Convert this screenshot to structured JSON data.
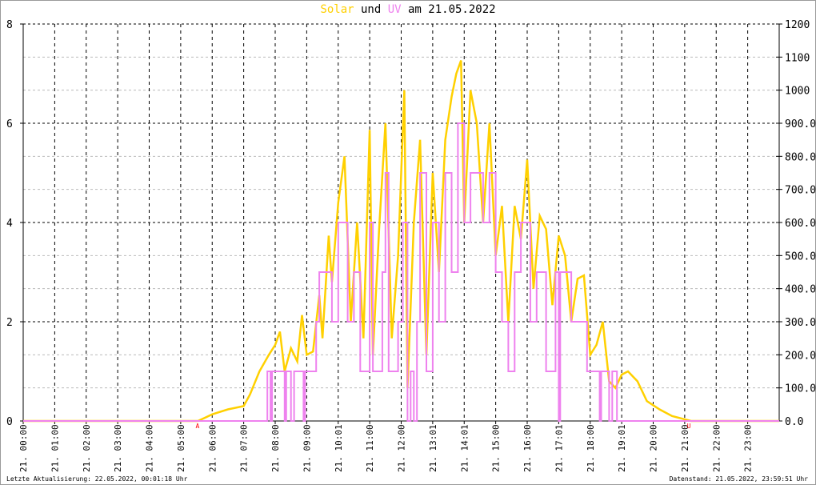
{
  "title": {
    "part1": "Solar",
    "part2": " und ",
    "part3": "UV",
    "part4": " am 21.05.2022"
  },
  "footer": {
    "left": "Letzte Aktualisierung: 22.05.2022, 00:01:18 Uhr",
    "right": "Datenstand: 21.05.2022, 23:59:51 Uhr"
  },
  "colors": {
    "solar": "#ffd000",
    "uv": "#ee82ee",
    "marker": "#ff0000"
  },
  "chart_data": {
    "type": "line",
    "title": "Solar und UV am 21.05.2022",
    "xlim": [
      0,
      24
    ],
    "ylim_left": [
      0,
      8
    ],
    "ylim_right": [
      0,
      1200
    ],
    "left_ticks": [
      "0",
      "2",
      "4",
      "6",
      "8"
    ],
    "right_ticks": [
      "0.0",
      "100.0",
      "200.0",
      "300.0",
      "400.0",
      "500.0",
      "600.0",
      "700.0",
      "800.0",
      "900.0",
      "1000",
      "1100",
      "1200"
    ],
    "x_tick_labels": [
      "21. 00:00",
      "21. 01:00",
      "21. 02:00",
      "21. 03:00",
      "21. 04:00",
      "21. 05:00",
      "21. 06:00",
      "21. 07:00",
      "21. 08:00",
      "21. 09:00",
      "21. 10:01",
      "21. 11:00",
      "21. 12:00",
      "21. 13:01",
      "21. 14:01",
      "21. 15:00",
      "21. 16:00",
      "21. 17:01",
      "21. 18:00",
      "21. 19:01",
      "21. 20:00",
      "21. 21:00",
      "21. 22:00",
      "21. 23:00"
    ],
    "markers": [
      {
        "label": "A",
        "x": 5.55
      },
      {
        "label": "U",
        "x": 21.15
      }
    ],
    "series": [
      {
        "name": "Solar",
        "axis": "right",
        "points": [
          [
            0,
            0
          ],
          [
            5.55,
            0
          ],
          [
            6.0,
            20
          ],
          [
            6.5,
            35
          ],
          [
            7.0,
            45
          ],
          [
            7.2,
            80
          ],
          [
            7.5,
            150
          ],
          [
            7.8,
            200
          ],
          [
            8.0,
            230
          ],
          [
            8.15,
            270
          ],
          [
            8.3,
            150
          ],
          [
            8.5,
            220
          ],
          [
            8.7,
            180
          ],
          [
            8.85,
            320
          ],
          [
            9.0,
            200
          ],
          [
            9.2,
            210
          ],
          [
            9.4,
            380
          ],
          [
            9.5,
            250
          ],
          [
            9.7,
            560
          ],
          [
            9.8,
            420
          ],
          [
            10.0,
            660
          ],
          [
            10.2,
            800
          ],
          [
            10.4,
            300
          ],
          [
            10.6,
            600
          ],
          [
            10.8,
            250
          ],
          [
            11.0,
            880
          ],
          [
            11.1,
            200
          ],
          [
            11.3,
            580
          ],
          [
            11.5,
            900
          ],
          [
            11.7,
            250
          ],
          [
            11.9,
            500
          ],
          [
            12.1,
            1000
          ],
          [
            12.2,
            100
          ],
          [
            12.4,
            600
          ],
          [
            12.6,
            850
          ],
          [
            12.8,
            200
          ],
          [
            13.0,
            750
          ],
          [
            13.2,
            450
          ],
          [
            13.4,
            850
          ],
          [
            13.6,
            980
          ],
          [
            13.75,
            1050
          ],
          [
            13.9,
            1090
          ],
          [
            14.0,
            600
          ],
          [
            14.2,
            1000
          ],
          [
            14.4,
            900
          ],
          [
            14.6,
            600
          ],
          [
            14.8,
            900
          ],
          [
            15.0,
            500
          ],
          [
            15.2,
            650
          ],
          [
            15.4,
            300
          ],
          [
            15.6,
            650
          ],
          [
            15.8,
            550
          ],
          [
            16.0,
            790
          ],
          [
            16.2,
            400
          ],
          [
            16.4,
            620
          ],
          [
            16.6,
            580
          ],
          [
            16.8,
            350
          ],
          [
            17.0,
            560
          ],
          [
            17.2,
            500
          ],
          [
            17.4,
            300
          ],
          [
            17.6,
            430
          ],
          [
            17.8,
            440
          ],
          [
            18.0,
            200
          ],
          [
            18.2,
            230
          ],
          [
            18.4,
            300
          ],
          [
            18.6,
            120
          ],
          [
            18.8,
            100
          ],
          [
            19.0,
            140
          ],
          [
            19.2,
            150
          ],
          [
            19.5,
            120
          ],
          [
            19.8,
            60
          ],
          [
            20.2,
            35
          ],
          [
            20.6,
            15
          ],
          [
            21.0,
            5
          ],
          [
            21.2,
            0
          ],
          [
            24,
            0
          ]
        ]
      },
      {
        "name": "UV",
        "axis": "left",
        "step": true,
        "points": [
          [
            0,
            0
          ],
          [
            7.75,
            1
          ],
          [
            7.85,
            0
          ],
          [
            7.9,
            1
          ],
          [
            8.3,
            0
          ],
          [
            8.35,
            1
          ],
          [
            8.5,
            0
          ],
          [
            8.6,
            1
          ],
          [
            8.9,
            0
          ],
          [
            8.95,
            1
          ],
          [
            9.3,
            2
          ],
          [
            9.4,
            3
          ],
          [
            9.8,
            2
          ],
          [
            10.0,
            4
          ],
          [
            10.3,
            2
          ],
          [
            10.5,
            3
          ],
          [
            10.7,
            1
          ],
          [
            11.0,
            4
          ],
          [
            11.1,
            1
          ],
          [
            11.4,
            3
          ],
          [
            11.5,
            5
          ],
          [
            11.6,
            1
          ],
          [
            11.9,
            2
          ],
          [
            12.05,
            4
          ],
          [
            12.2,
            0
          ],
          [
            12.3,
            1
          ],
          [
            12.4,
            0
          ],
          [
            12.5,
            2
          ],
          [
            12.6,
            5
          ],
          [
            12.8,
            1
          ],
          [
            13.0,
            4
          ],
          [
            13.2,
            2
          ],
          [
            13.4,
            5
          ],
          [
            13.6,
            3
          ],
          [
            13.8,
            6
          ],
          [
            14.0,
            4
          ],
          [
            14.2,
            5
          ],
          [
            14.6,
            4
          ],
          [
            14.8,
            5
          ],
          [
            15.0,
            3
          ],
          [
            15.2,
            2
          ],
          [
            15.4,
            1
          ],
          [
            15.6,
            3
          ],
          [
            15.8,
            4
          ],
          [
            16.1,
            2
          ],
          [
            16.3,
            3
          ],
          [
            16.6,
            1
          ],
          [
            16.9,
            3
          ],
          [
            17.0,
            0
          ],
          [
            17.05,
            3
          ],
          [
            17.4,
            2
          ],
          [
            17.9,
            1
          ],
          [
            18.3,
            0
          ],
          [
            18.35,
            1
          ],
          [
            18.6,
            0
          ],
          [
            18.7,
            1
          ],
          [
            18.85,
            0
          ],
          [
            24,
            0
          ]
        ]
      }
    ]
  }
}
